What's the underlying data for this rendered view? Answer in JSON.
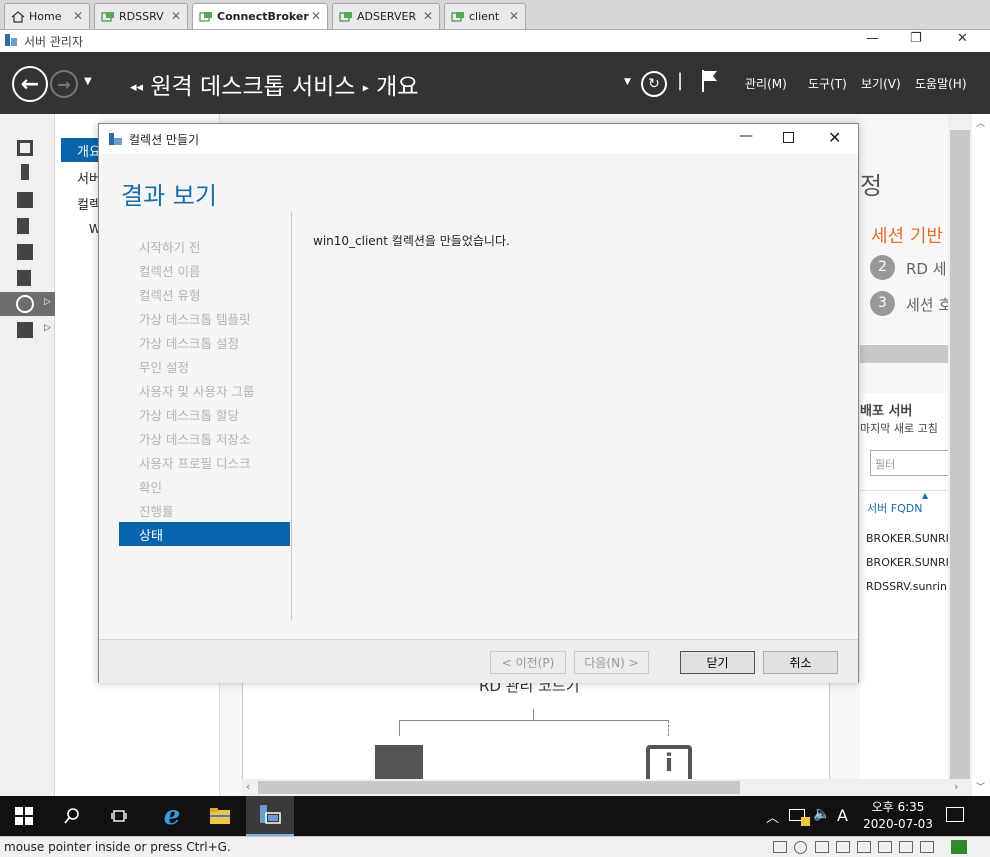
{
  "vm_tabs": [
    {
      "label": "Home"
    },
    {
      "label": "RDSSRV"
    },
    {
      "label": "ConnectBroker"
    },
    {
      "label": "ADSERVER"
    },
    {
      "label": "client"
    }
  ],
  "window": {
    "title": "서버 관리자"
  },
  "header": {
    "breadcrumb_root": "원격 데스크톱 서비스",
    "breadcrumb_page": "개요",
    "menus": [
      "관리(M)",
      "도구(T)",
      "보기(V)",
      "도움말(H)"
    ]
  },
  "nav2": {
    "items": [
      "개요",
      "서버",
      "컬렉",
      "W"
    ]
  },
  "background": {
    "right_heading_partial": "정",
    "session_heading": "세션 기반",
    "step2": "2",
    "step2_text": "RD 세",
    "step3": "3",
    "step3_text": "세션 호",
    "deploy_servers": "배포 서버",
    "last_refresh": "마지막 새로 고침",
    "filter_placeholder": "필터",
    "column_server_fqdn": "서버 FQDN",
    "rows": [
      "BROKER.SUNRI",
      "BROKER.SUNRI",
      "RDSSRV.sunrin."
    ],
    "rd_gateway": "RD 관리 코드기"
  },
  "dialog": {
    "title": "컬렉션 만들기",
    "heading": "결과 보기",
    "steps": [
      "시작하기 전",
      "컬렉션 이름",
      "컬렉션 유형",
      "가상 데스크톱 템플릿",
      "가상 데스크톱 설정",
      "무인 설정",
      "사용자 및 사용자 그룹",
      "가상 데스크톱 할당",
      "가상 데스크톱 저장소",
      "사용자 프로필 디스크",
      "확인",
      "진행률"
    ],
    "current_step": "상태",
    "message": "win10_client 컬렉션을 만들었습니다.",
    "buttons": {
      "prev": "< 이전(P)",
      "next": "다음(N) >",
      "close": "닫기",
      "cancel": "취소"
    }
  },
  "taskbar": {
    "ime": "A",
    "time": "오후 6:35",
    "date": "2020-07-03"
  },
  "statusbar": {
    "text": "mouse pointer inside or press Ctrl+G."
  },
  "colors": {
    "accent": "#0a64ad",
    "header_bg": "#333333",
    "orange": "#e8702a"
  }
}
